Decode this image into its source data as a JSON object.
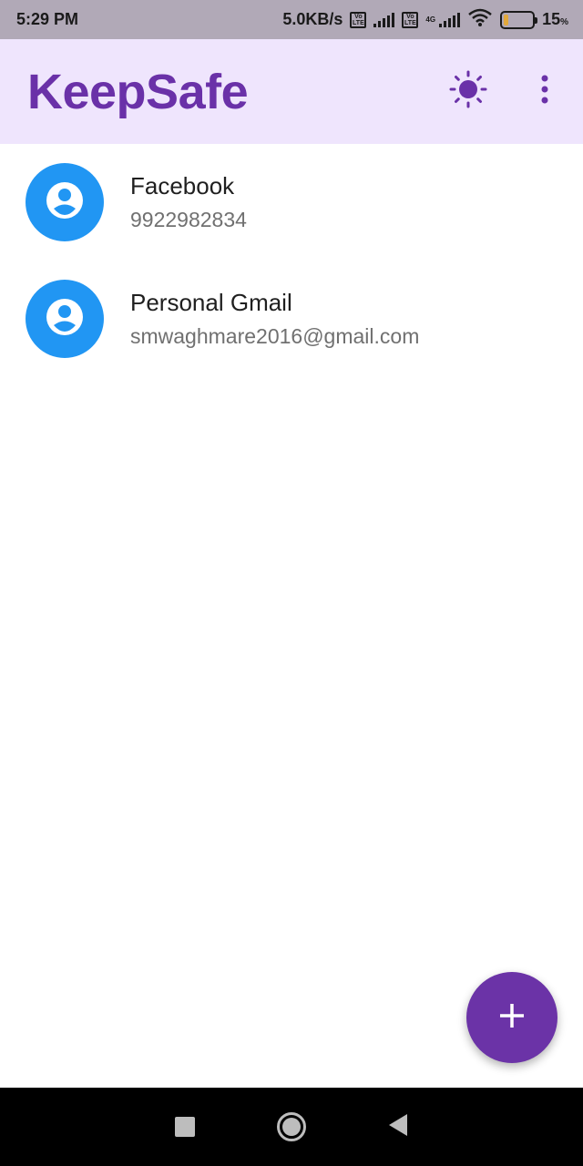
{
  "status_bar": {
    "time": "5:29 PM",
    "net_speed": "5.0KB/s",
    "sim1_badge_top": "Vo",
    "sim1_badge_bottom": "LTE",
    "sim2_badge_top": "Vo",
    "sim2_badge_bottom": "LTE",
    "sim2_network": "4G",
    "battery_percent": "15",
    "battery_unit": "%",
    "battery_level": 0.15,
    "battery_color": "#e2a83a"
  },
  "app_bar": {
    "title": "KeepSafe",
    "theme_toggle_icon": "sun-icon",
    "menu_icon": "more-vert-icon",
    "accent_color": "#6a31a8",
    "background_color": "#efe5fd"
  },
  "accounts": [
    {
      "title": "Facebook",
      "subtitle": "9922982834",
      "icon": "account-circle-icon"
    },
    {
      "title": "Personal Gmail",
      "subtitle": "smwaghmare2016@gmail.com",
      "icon": "account-circle-icon"
    }
  ],
  "avatar_color": "#2196f3",
  "fab": {
    "icon": "plus-icon",
    "color": "#6b33a7"
  },
  "nav_bar": {
    "recents_icon": "square-icon",
    "home_icon": "circle-icon",
    "back_icon": "triangle-back-icon"
  }
}
